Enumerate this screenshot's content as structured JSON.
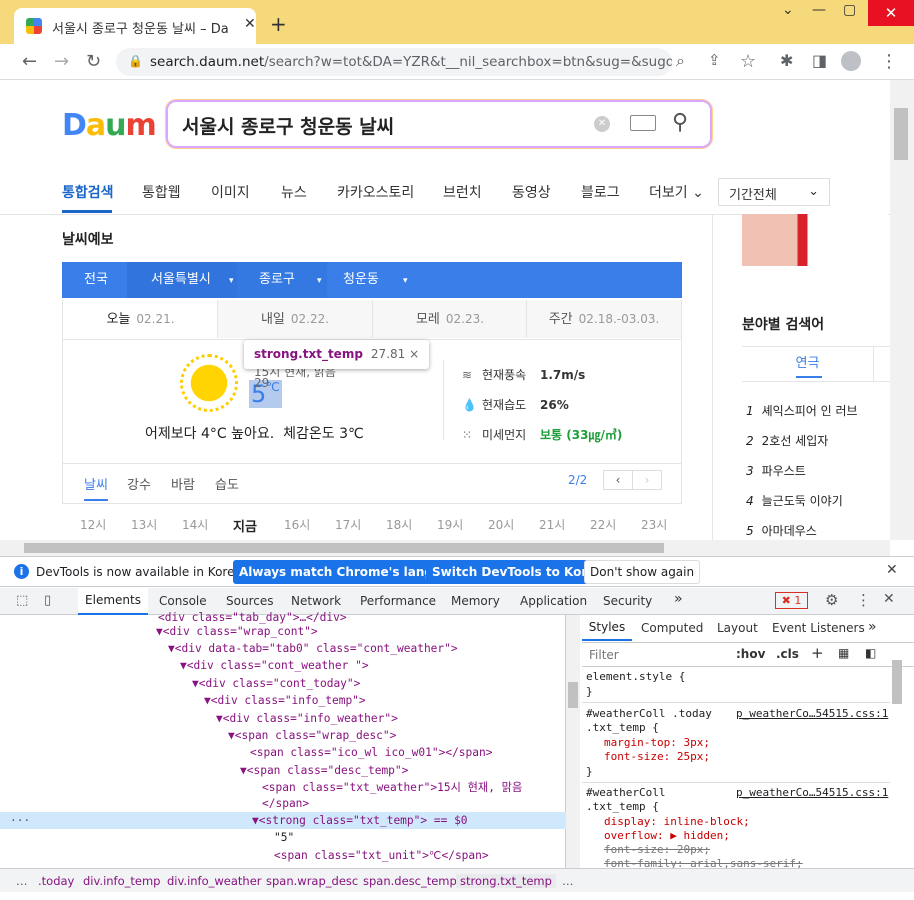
{
  "browser": {
    "tab_title": "서울시 종로구 청운동 날씨 – Da",
    "url_host": "search.daum.net",
    "url_path": "/search?w=tot&DA=YZR&t__nil_searchbox=btn&sug=&sugo=..."
  },
  "search": {
    "logo": "Daum",
    "query": "서울시 종로구 청운동 날씨"
  },
  "gnb": {
    "items": [
      "통합검색",
      "통합웹",
      "이미지",
      "뉴스",
      "카카오스토리",
      "브런치",
      "동영상",
      "블로그",
      "더보기"
    ],
    "period": "기간전체"
  },
  "weather": {
    "title": "날씨예보",
    "locations": [
      "전국",
      "서울특별시",
      "종로구",
      "청운동"
    ],
    "day_tabs": [
      {
        "label": "오늘",
        "date": "02.21."
      },
      {
        "label": "내일",
        "date": "02.22."
      },
      {
        "label": "모레",
        "date": "02.23."
      },
      {
        "label": "주간",
        "date": "02.18.-03.03."
      }
    ],
    "desc": "15시 현재, 맑음",
    "temp": "5",
    "temp_unit": "℃",
    "compare_text": "어제보다 4°C 높아요.",
    "feels_like": "체감온도 3℃",
    "metrics": [
      {
        "icon": "wind-icon",
        "label": "현재풍속",
        "value": "1.7m/s"
      },
      {
        "icon": "drop-icon",
        "label": "현재습도",
        "value": "26%"
      },
      {
        "icon": "dust-icon",
        "label": "미세먼지",
        "value": "보통 (33㎍/㎥)"
      }
    ],
    "sub_tabs": [
      "날씨",
      "강수",
      "바람",
      "습도"
    ],
    "pager": "2/2",
    "hours": [
      "12시",
      "13시",
      "14시",
      "지금",
      "16시",
      "17시",
      "18시",
      "19시",
      "20시",
      "21시",
      "22시",
      "23시"
    ]
  },
  "tooltip": {
    "name": "strong.txt_temp",
    "size": "27.81 × 29"
  },
  "sidebar": {
    "category_title": "분야별 검색어",
    "category_tab": "연극",
    "ranks": [
      {
        "num": "1",
        "text": "셰익스피어 인 러브"
      },
      {
        "num": "2",
        "text": "2호선 세입자"
      },
      {
        "num": "3",
        "text": "파우스트"
      },
      {
        "num": "4",
        "text": "늘근도둑 이야기"
      },
      {
        "num": "5",
        "text": "아마데우스"
      }
    ]
  },
  "devtools": {
    "info_text": "DevTools is now available in Korean!",
    "btn_match": "Always match Chrome's language",
    "btn_switch": "Switch DevTools to Korean",
    "btn_dont": "Don't show again",
    "tabs": [
      "Elements",
      "Console",
      "Sources",
      "Network",
      "Performance",
      "Memory",
      "Application",
      "Security"
    ],
    "error_count": "1",
    "styles_tabs": [
      "Styles",
      "Computed",
      "Layout",
      "Event Listeners"
    ],
    "filter_placeholder": "Filter",
    "hov": ":hov",
    "cls": ".cls",
    "breadcrumbs": [
      ".today",
      "div.info_temp",
      "div.info_weather",
      "span.wrap_desc",
      "span.desc_temp",
      "strong.txt_temp"
    ]
  },
  "dom_lines": [
    "<div class=\"tab_day\">…</div>",
    "▼<div class=\"wrap_cont\">",
    "▼<div data-tab=\"tab0\" class=\"cont_weather\">",
    "▼<div class=\"cont_weather \">",
    "▼<div class=\"cont_today\">",
    "▼<div class=\"info_temp\">",
    "▼<div class=\"info_weather\">",
    "▼<span class=\"wrap_desc\">",
    "<span class=\"ico_wl ico_w01\"></span>",
    "▼<span class=\"desc_temp\">",
    "<span class=\"txt_weather\">15시 현재, 맑음",
    "</span>",
    "▼<strong class=\"txt_temp\"> == $0",
    "\"5\"",
    "<span class=\"txt_unit\">℃</span>"
  ],
  "style_rules": {
    "element_style": "element.style {",
    "r1_selector": "#weatherColl .today",
    "r1_selector2": ".txt_temp {",
    "r1_source": "p_weatherCo…54515.css:1",
    "r1_p1": "margin-top: 3px;",
    "r1_p2": "font-size: 25px;",
    "r2_selector": "#weatherColl",
    "r2_selector2": ".txt_temp {",
    "r2_source": "p_weatherCo…54515.css:1",
    "r2_p1": "display: inline-block;",
    "r2_p2": "overflow: ▶ hidden;",
    "r2_p3": "font-size: 20px;",
    "r2_p4": "font-family: arial,sans-serif;"
  },
  "colors": {
    "accent": "#1a73e8",
    "daum_blue": "#3a7eea",
    "title_bar": "#f6d97a"
  }
}
